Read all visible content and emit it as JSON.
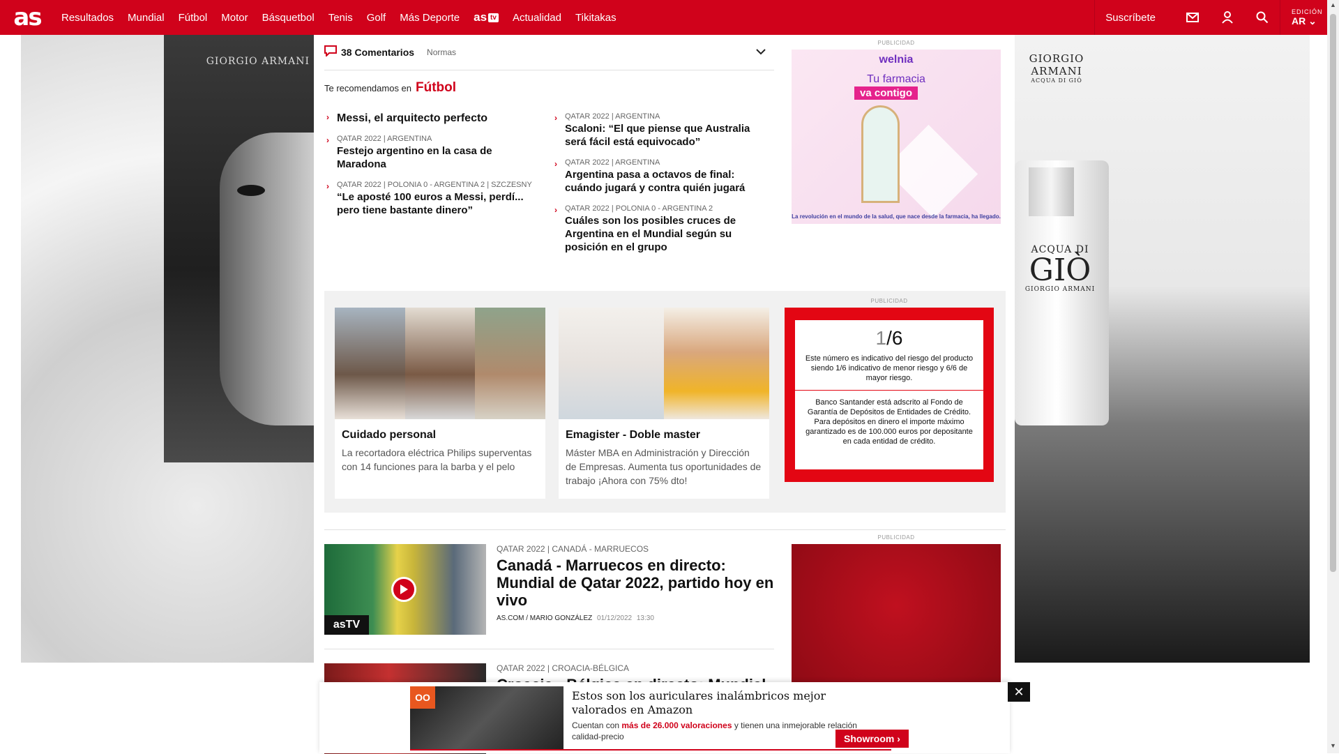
{
  "nav": {
    "logo": "as",
    "items": [
      "Resultados",
      "Mundial",
      "Fútbol",
      "Motor",
      "Básquetbol",
      "Tenis",
      "Golf",
      "Más Deporte"
    ],
    "astv_label": "as",
    "astv_tv": "tv",
    "items_after": [
      "Actualidad",
      "Tikitakas"
    ],
    "subscribe": "Suscríbete",
    "edition_label": "EDICIÓN",
    "edition_value": "AR"
  },
  "comments": {
    "count_label": "38 Comentarios",
    "norms": "Normas"
  },
  "recommend": {
    "lead": "Te recomendamos en",
    "section": "Fútbol",
    "left": [
      {
        "kicker": "",
        "title": "Messi, el arquitecto perfecto"
      },
      {
        "kicker": "QATAR 2022 | ARGENTINA",
        "title": "Festejo argentino en la casa de Maradona"
      },
      {
        "kicker": "QATAR 2022 | POLONIA 0 - ARGENTINA 2 | SZCZESNY",
        "title": "“Le aposté 100 euros a Messi, perdí... pero tiene bastante dinero”"
      }
    ],
    "right": [
      {
        "kicker": "QATAR 2022 | ARGENTINA",
        "title": "Scaloni: “El que piense que Australia será fácil está equivocado”"
      },
      {
        "kicker": "QATAR 2022 | ARGENTINA",
        "title": "Argentina pasa a octavos de final: cuándo jugará y contra quién jugará"
      },
      {
        "kicker": "QATAR 2022 | POLONIA 0 - ARGENTINA 2",
        "title": "Cuáles son los posibles cruces de Argentina en el Mundial según su posición en el grupo"
      }
    ]
  },
  "ads": {
    "label": "PUBLICIDAD",
    "welnia_brand": "welnia",
    "welnia_tagline": "Tu farmacia",
    "welnia_tagline2": "va contigo",
    "welnia_footer": "La revolución en el mundo de la salud, que nace desde la farmacia, ha llegado.",
    "skin_left_brand": "GIORGIO ARMANI",
    "skin_right_brand": "GIORGIO ARMANI",
    "skin_right_sub": "ACQUA DI GIÒ",
    "bottle_line1": "ACQUA DI",
    "bottle_line2": "GIÒ",
    "bottle_line3": "GIORGIO ARMANI"
  },
  "sponsored": [
    {
      "title": "Cuidado personal",
      "desc": "La recortadora eléctrica Philips superventas con 14 funciones para la barba y el pelo"
    },
    {
      "title": "Emagister - Doble master",
      "desc": "Máster MBA en Administración y Dirección de Empresas. Aumenta tus oportunidades de trabajo ¡Ahora con 75% dto!"
    }
  ],
  "santander": {
    "frac_num": "1",
    "frac_den": "/6",
    "text1": "Este número es indicativo del riesgo del producto siendo 1/6 indicativo de menor riesgo y 6/6 de mayor riesgo.",
    "text2": "Banco Santander está adscrito al Fondo de Garantía de Depósitos de Entidades de Crédito. Para depósitos en dinero el importe máximo garantizado es de 100.000 euros por depositante en cada entidad de crédito."
  },
  "news": [
    {
      "kicker": "QATAR 2022 | CANADÁ - MARRUECOS",
      "title": "Canadá - Marruecos en directo: Mundial de Qatar 2022, partido hoy en vivo",
      "author": "AS.COM / MARIO GONZÁLEZ",
      "date": "01/12/2022",
      "time": "13:30",
      "badge": "asTV"
    },
    {
      "kicker": "QATAR 2022 | CROACIA-BÉLGICA",
      "title": "Croacia - Bélgica en directo: Mundial"
    }
  ],
  "sticky": {
    "title": "Estos son los auriculares inalámbricos mejor valorados en Amazon",
    "desc_pre": "Cuentan con ",
    "desc_hl": "más de 26.000 valoraciones",
    "desc_post": " y tienen una inmejorable relación calidad-precio",
    "button": "Showroom",
    "icon": "OO",
    "close": "✕"
  }
}
